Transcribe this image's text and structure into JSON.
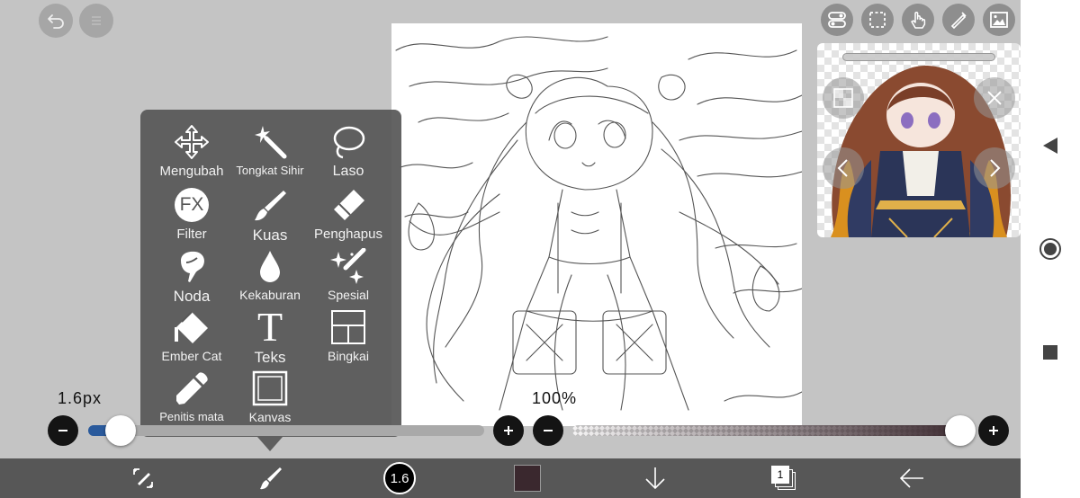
{
  "tools": [
    {
      "label": "Mengubah",
      "icon": "move-arrows-icon"
    },
    {
      "label": "Tongkat Sihir",
      "icon": "magic-wand-icon"
    },
    {
      "label": "Laso",
      "icon": "lasso-icon"
    },
    {
      "label": "Filter",
      "icon": "fx-filter-icon",
      "icon_text": "FX"
    },
    {
      "label": "Kuas",
      "icon": "brush-icon"
    },
    {
      "label": "Penghapus",
      "icon": "eraser-icon"
    },
    {
      "label": "Noda",
      "icon": "smudge-icon"
    },
    {
      "label": "Kekaburan",
      "icon": "blur-drop-icon"
    },
    {
      "label": "Spesial",
      "icon": "special-sparkle-icon"
    },
    {
      "label": "Ember Cat",
      "icon": "paint-bucket-icon"
    },
    {
      "label": "Teks",
      "icon": "text-icon",
      "icon_text": "T"
    },
    {
      "label": "Bingkai",
      "icon": "frame-divider-icon"
    },
    {
      "label": "Penitis mata",
      "icon": "eyedropper-icon"
    },
    {
      "label": "Kanvas",
      "icon": "canvas-square-icon"
    }
  ],
  "brush": {
    "size_label": "1.6px",
    "size_badge": "1.6",
    "size_fraction": 0.06,
    "opacity_label": "100%",
    "opacity_fraction": 1.0,
    "color": "#3a282e"
  },
  "layers": {
    "count_badge": "1"
  },
  "colors": {
    "accent": "#2a5a9c",
    "toolbar": "#575757",
    "popup": "#565656",
    "background": "#c4c4c4"
  },
  "top_right_icons": [
    "toggle-settings-icon",
    "selection-icon",
    "hand-touch-icon",
    "ruler-pen-icon",
    "image-icon"
  ],
  "bottom_icons": [
    "transform-tool-icon",
    "brush-tool-icon",
    "brush-size-icon",
    "color-swatch",
    "download-arrow-icon",
    "layers-icon",
    "back-arrow-icon"
  ]
}
